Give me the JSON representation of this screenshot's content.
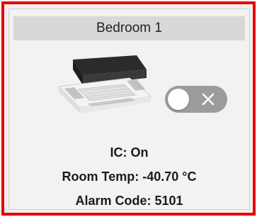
{
  "card": {
    "title": "Bedroom 1",
    "border_color": "#e60000",
    "ic_label": "IC: On",
    "room_temp_label": "Room Temp: -40.70 °C",
    "alarm_code_label": "Alarm Code: 5101"
  },
  "device": {
    "image": "ceiling-cassette-ac-unit",
    "toggle": {
      "state": "off",
      "icon": "x-icon",
      "track_color": "#9b9b9b"
    }
  }
}
